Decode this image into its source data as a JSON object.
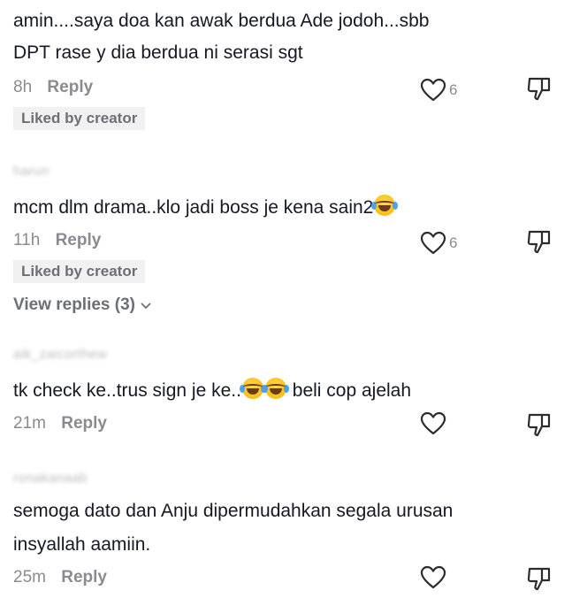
{
  "comments": [
    {
      "username": "",
      "text": "amin....saya doa kan awak berdua Ade jodoh...sbb",
      "text2": "DPT rase y dia berdua ni serasi sgt",
      "time": "8h",
      "reply": "Reply",
      "likes": "6",
      "badge": "Liked by creator"
    },
    {
      "username": "harun",
      "text": "mcm dlm drama..klo jadi boss je kena sain2",
      "time": "11h",
      "reply": "Reply",
      "likes": "6",
      "badge": "Liked by creator",
      "view_replies": "View replies (3)"
    },
    {
      "username": "aik_zaicorthew",
      "text_a": "tk check ke..trus sign je ke..",
      "text_b": " beli cop ajelah",
      "time": "21m",
      "reply": "Reply",
      "likes": ""
    },
    {
      "username": "ronakanaab",
      "text": "semoga dato dan Anju dipermudahkan segala urusan",
      "text2": "insyallah aamiin.",
      "time": "25m",
      "reply": "Reply",
      "likes": ""
    }
  ],
  "icons": {
    "like": "heart-outline-icon",
    "dislike": "thumbs-down-icon",
    "emoji": "face-with-tears-of-joy-emoji",
    "chevron": "chevron-down-icon"
  }
}
